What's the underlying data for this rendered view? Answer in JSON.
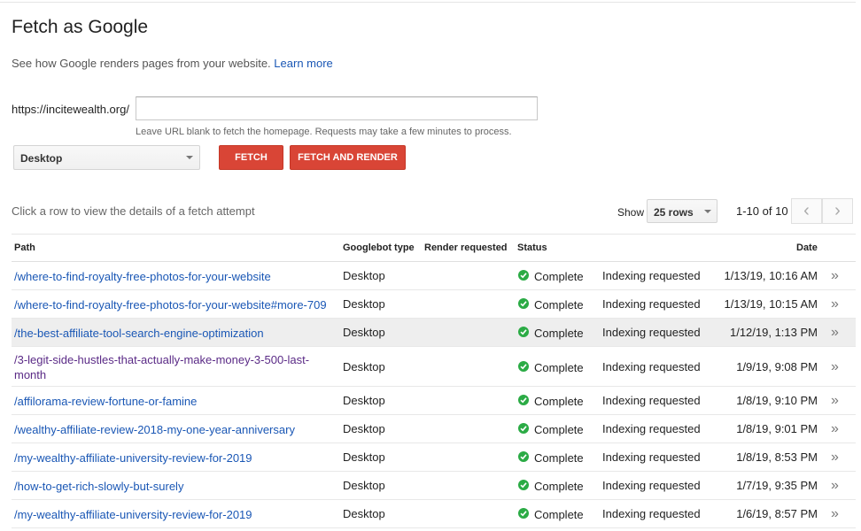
{
  "header": {
    "title": "Fetch as Google",
    "subtitle": "See how Google renders pages from your website.",
    "learn_more": "Learn more"
  },
  "form": {
    "url_prefix": "https://incitewealth.org/",
    "url_value": "",
    "hint": "Leave URL blank to fetch the homepage. Requests may take a few minutes to process.",
    "device": "Desktop",
    "fetch_label": "FETCH",
    "fetch_render_label": "FETCH AND RENDER"
  },
  "table_controls": {
    "row_hint": "Click a row to view the details of a fetch attempt",
    "show_label": "Show",
    "rows_value": "25 rows",
    "page_range": "1-10 of 10",
    "prev_icon": "chevron-left-icon",
    "next_icon": "chevron-right-icon"
  },
  "table": {
    "columns": [
      "Path",
      "Googlebot type",
      "Render requested",
      "Status",
      "Date"
    ],
    "rows": [
      {
        "path": "/where-to-find-royalty-free-photos-for-your-website",
        "type": "Desktop",
        "status": "Complete",
        "indexing": "Indexing requested",
        "date": "1/13/19, 10:16 AM"
      },
      {
        "path": "/where-to-find-royalty-free-photos-for-your-website#more-709",
        "type": "Desktop",
        "status": "Complete",
        "indexing": "Indexing requested",
        "date": "1/13/19, 10:15 AM"
      },
      {
        "path": "/the-best-affiliate-tool-search-engine-optimization",
        "type": "Desktop",
        "status": "Complete",
        "indexing": "Indexing requested",
        "date": "1/12/19, 1:13 PM"
      },
      {
        "path": "/3-legit-side-hustles-that-actually-make-money-3-500-last-month",
        "type": "Desktop",
        "status": "Complete",
        "indexing": "Indexing requested",
        "date": "1/9/19, 9:08 PM"
      },
      {
        "path": "/affilorama-review-fortune-or-famine",
        "type": "Desktop",
        "status": "Complete",
        "indexing": "Indexing requested",
        "date": "1/8/19, 9:10 PM"
      },
      {
        "path": "/wealthy-affiliate-review-2018-my-one-year-anniversary",
        "type": "Desktop",
        "status": "Complete",
        "indexing": "Indexing requested",
        "date": "1/8/19, 9:01 PM"
      },
      {
        "path": "/my-wealthy-affiliate-university-review-for-2019",
        "type": "Desktop",
        "status": "Complete",
        "indexing": "Indexing requested",
        "date": "1/8/19, 8:53 PM"
      },
      {
        "path": "/how-to-get-rich-slowly-but-surely",
        "type": "Desktop",
        "status": "Complete",
        "indexing": "Indexing requested",
        "date": "1/7/19, 9:35 PM"
      },
      {
        "path": "/my-wealthy-affiliate-university-review-for-2019",
        "type": "Desktop",
        "status": "Complete",
        "indexing": "Indexing requested",
        "date": "1/6/19, 8:57 PM"
      }
    ]
  },
  "colors": {
    "link": "#1a57b5",
    "visited_link": "#5a2a86",
    "button_red": "#d94536",
    "check_green": "#2bab45",
    "row_highlight": "#eeeeee"
  }
}
